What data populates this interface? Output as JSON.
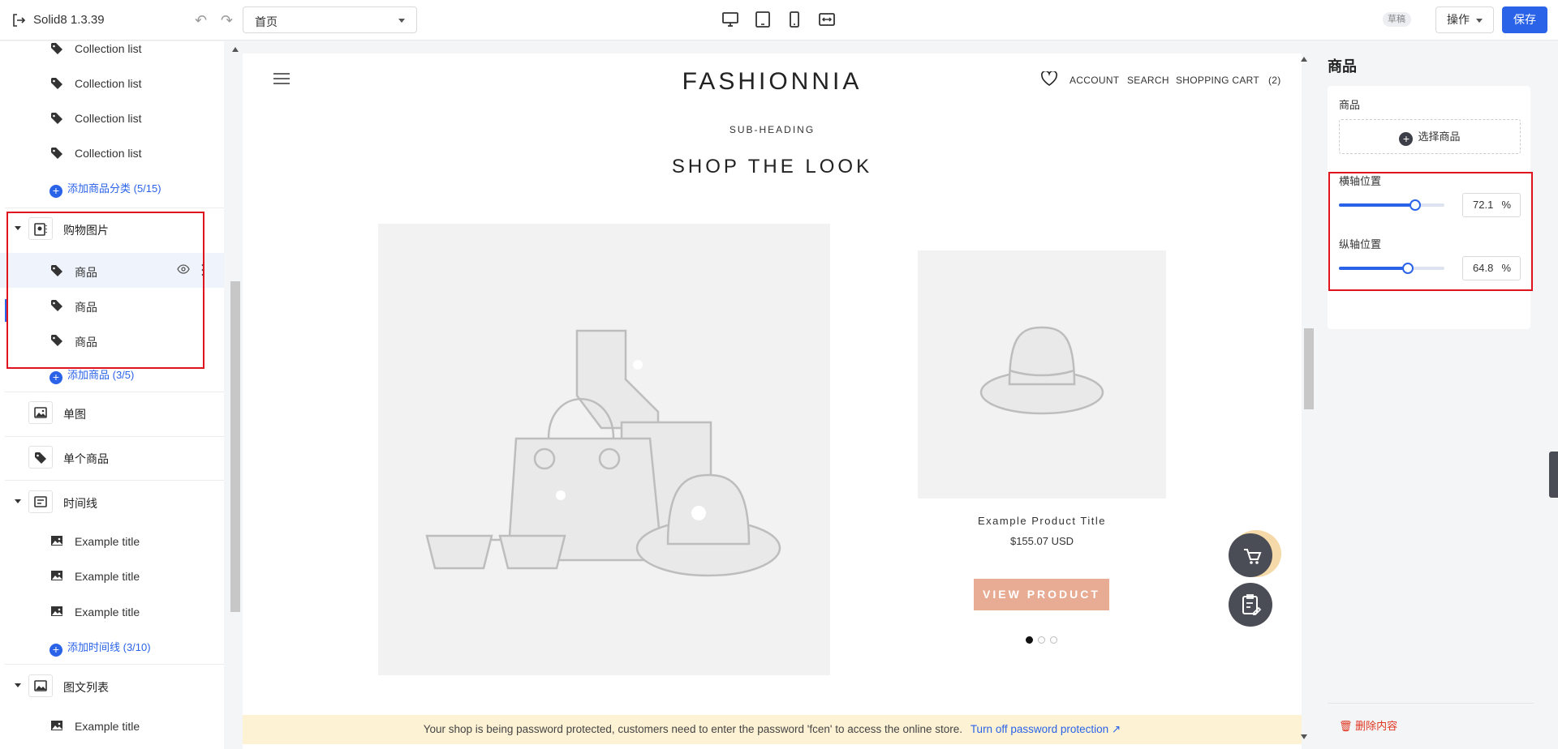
{
  "topbar": {
    "app_name": "Solid8 1.3.39",
    "page_select": "首页",
    "draft_badge": "草稿",
    "operations_label": "操作",
    "save_label": "保存",
    "accent": "#2a63e8"
  },
  "sidebar": {
    "collection_items": [
      "Collection list",
      "Collection list",
      "Collection list",
      "Collection list"
    ],
    "add_collection": "添加商品分类 (5/15)",
    "shopping_group": "购物图片",
    "product_items": [
      "商品",
      "商品",
      "商品"
    ],
    "add_product": "添加商品 (3/5)",
    "single_image": "单图",
    "single_product": "单个商品",
    "timeline_group": "时间线",
    "timeline_items": [
      "Example title",
      "Example title",
      "Example title"
    ],
    "add_timeline": "添加时间线 (3/10)",
    "image_text_group": "图文列表",
    "image_text_items": [
      "Example title"
    ]
  },
  "store": {
    "logo": "FASHIONNIA",
    "nav_account": "ACCOUNT",
    "nav_search": "SEARCH",
    "nav_cart": "SHOPPING CART",
    "cart_count": "(2)",
    "sub_heading": "SUB-HEADING",
    "title": "SHOP THE LOOK",
    "product_title": "Example Product Title",
    "product_price": "$155.07 USD",
    "view_button": "VIEW PRODUCT",
    "button_color": "#e8ab93",
    "carousel_active": 1,
    "carousel_total": 3
  },
  "banner": {
    "message": "Your shop is being password protected, customers need to enter the password 'fcen' to access the online store.",
    "link": "Turn off password protection"
  },
  "panel": {
    "title": "商品",
    "product_label": "商品",
    "choose_product": "选择商品",
    "horizontal_label": "横轴位置",
    "horizontal_value": "72.1",
    "vertical_label": "纵轴位置",
    "vertical_value": "64.8",
    "unit": "%",
    "delete_label": "删除内容"
  }
}
